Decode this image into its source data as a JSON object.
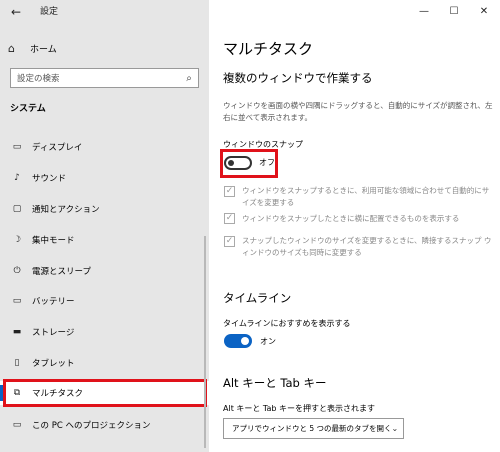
{
  "app": {
    "title": "設定"
  },
  "sidebar": {
    "home_label": "ホーム",
    "search_placeholder": "設定の検索",
    "section_label": "システム",
    "items": [
      {
        "label": "ディスプレイ",
        "icon": "monitor-icon"
      },
      {
        "label": "サウンド",
        "icon": "speaker-icon"
      },
      {
        "label": "通知とアクション",
        "icon": "notification-icon"
      },
      {
        "label": "集中モード",
        "icon": "moon-icon"
      },
      {
        "label": "電源とスリープ",
        "icon": "power-icon"
      },
      {
        "label": "バッテリー",
        "icon": "battery-icon"
      },
      {
        "label": "ストレージ",
        "icon": "storage-icon"
      },
      {
        "label": "タブレット",
        "icon": "tablet-icon"
      },
      {
        "label": "マルチタスク",
        "icon": "multitask-icon",
        "active": true
      },
      {
        "label": "この PC へのプロジェクション",
        "icon": "projection-icon"
      }
    ]
  },
  "main": {
    "page_title": "マルチタスク",
    "snap": {
      "heading": "複数のウィンドウで作業する",
      "description": "ウィンドウを画面の横や四隅にドラッグすると、自動的にサイズが調整され、左右に並べて表示されます。",
      "toggle_label": "ウィンドウのスナップ",
      "toggle_state": "オフ",
      "options": [
        "ウィンドウをスナップするときに、利用可能な領域に合わせて自動的にサイズを変更する",
        "ウィンドウをスナップしたときに横に配置できるものを表示する",
        "スナップしたウィンドウのサイズを変更するときに、隣接するスナップ ウィンドウのサイズも同時に変更する"
      ]
    },
    "timeline": {
      "heading": "タイムライン",
      "toggle_label": "タイムラインにおすすめを表示する",
      "toggle_state": "オン"
    },
    "alttab": {
      "heading": "Alt キーと Tab キー",
      "label": "Alt キーと Tab キーを押すと表示されます",
      "selected": "アプリでウィンドウと 5 つの最新のタブを開く"
    }
  },
  "colors": {
    "accent": "#0b63c4",
    "highlight": "#e0121a",
    "sidebar_bg": "#e6e6e6"
  }
}
